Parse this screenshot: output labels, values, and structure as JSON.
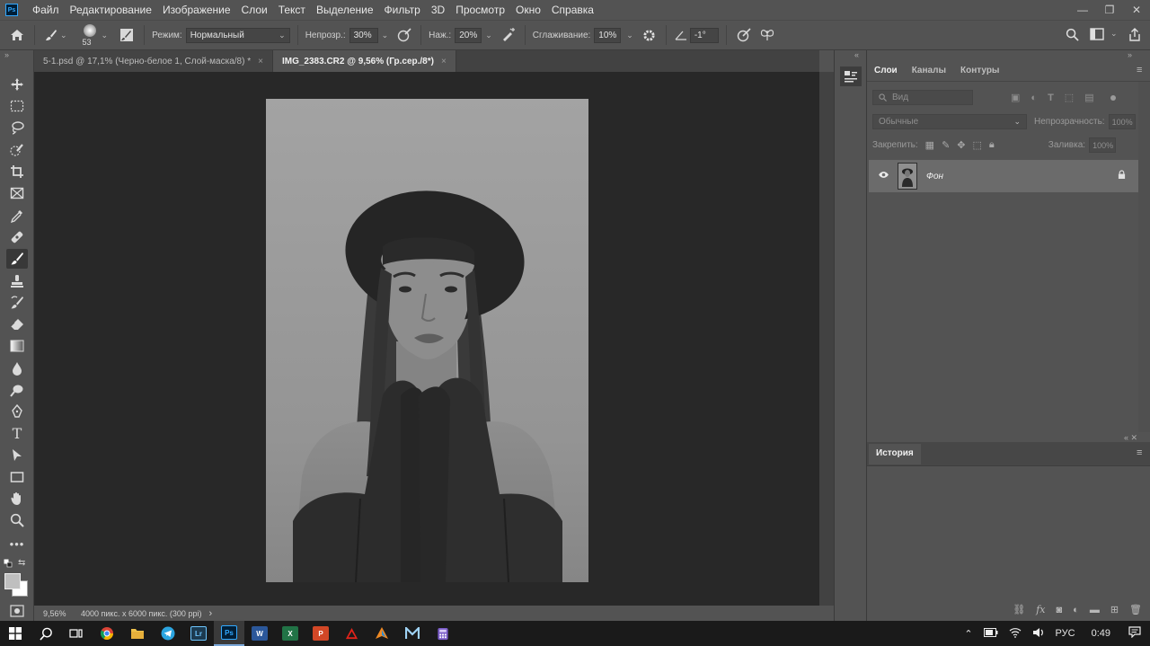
{
  "app": {
    "logo_text": "Ps",
    "menu": [
      "Файл",
      "Редактирование",
      "Изображение",
      "Слои",
      "Текст",
      "Выделение",
      "Фильтр",
      "3D",
      "Просмотр",
      "Окно",
      "Справка"
    ],
    "window_controls": [
      "—",
      "❐",
      "✕"
    ]
  },
  "options": {
    "brush_size": "53",
    "mode_label": "Режим:",
    "mode_value": "Нормальный",
    "opacity_label": "Непрозр.:",
    "opacity_value": "30%",
    "pressure_label": "Наж.:",
    "pressure_value": "20%",
    "smoothing_label": "Сглаживание:",
    "smoothing_value": "10%",
    "angle_value": "-1°"
  },
  "tabs": [
    {
      "label": "5-1.psd @ 17,1% (Черно-белое 1, Слой-маска/8) *",
      "close": "×"
    },
    {
      "label": "IMG_2383.CR2 @ 9,56% (Гр.сер./8*)",
      "close": "×"
    }
  ],
  "status": {
    "zoom": "9,56%",
    "doc_info": "4000 пикс. x 6000 пикс. (300 ppi)",
    "arrow": "›"
  },
  "layers_panel": {
    "tabs": [
      "Слои",
      "Каналы",
      "Контуры"
    ],
    "filter_placeholder": "Вид",
    "blend_mode": "Обычные",
    "opacity_label": "Непрозрачность:",
    "opacity_value": "100%",
    "lock_label": "Закрепить:",
    "fill_label": "Заливка:",
    "fill_value": "100%",
    "layers": [
      {
        "name": "Фон"
      }
    ]
  },
  "history_panel": {
    "title": "История"
  },
  "taskbar": {
    "apps": [
      {
        "name": "Lr",
        "color": "#1c3a4f",
        "text_color": "#6ec6ff"
      },
      {
        "name": "Ps",
        "color": "#001e36",
        "text_color": "#31a8ff"
      },
      {
        "name": "W",
        "color": "#2b579a",
        "text_color": "#ffffff"
      },
      {
        "name": "X",
        "color": "#217346",
        "text_color": "#ffffff"
      },
      {
        "name": "P",
        "color": "#d24726",
        "text_color": "#ffffff"
      }
    ],
    "language": "РУС",
    "time": "0:49"
  },
  "colors": {
    "accent": "#31a8ff",
    "panel_bg": "#535353",
    "canvas_bg": "#282828"
  }
}
